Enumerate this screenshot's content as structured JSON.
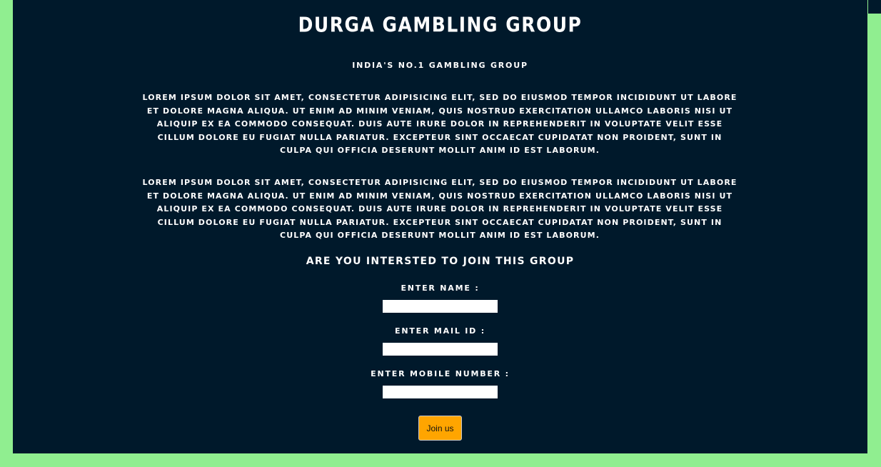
{
  "header": {
    "title": "DURGA GAMBLING GROUP",
    "subtitle": "INDIA'S NO.1 GAMBLING GROUP"
  },
  "content": {
    "paragraphs": [
      "LOREM IPSUM DOLOR SIT AMET, CONSECTETUR ADIPISICING ELIT, SED DO EIUSMOD TEMPOR INCIDIDUNT UT LABORE ET DOLORE MAGNA ALIQUA. UT ENIM AD MINIM VENIAM, QUIS NOSTRUD EXERCITATION ULLAMCO LABORIS NISI UT ALIQUIP EX EA COMMODO CONSEQUAT. DUIS AUTE IRURE DOLOR IN REPREHENDERIT IN VOLUPTATE VELIT ESSE CILLUM DOLORE EU FUGIAT NULLA PARIATUR. EXCEPTEUR SINT OCCAECAT CUPIDATAT NON PROIDENT, SUNT IN CULPA QUI OFFICIA DESERUNT MOLLIT ANIM ID EST LABORUM.",
      "LOREM IPSUM DOLOR SIT AMET, CONSECTETUR ADIPISICING ELIT, SED DO EIUSMOD TEMPOR INCIDIDUNT UT LABORE ET DOLORE MAGNA ALIQUA. UT ENIM AD MINIM VENIAM, QUIS NOSTRUD EXERCITATION ULLAMCO LABORIS NISI UT ALIQUIP EX EA COMMODO CONSEQUAT. DUIS AUTE IRURE DOLOR IN REPREHENDERIT IN VOLUPTATE VELIT ESSE CILLUM DOLORE EU FUGIAT NULLA PARIATUR. EXCEPTEUR SINT OCCAECAT CUPIDATAT NON PROIDENT, SUNT IN CULPA QUI OFFICIA DESERUNT MOLLIT ANIM ID EST LABORUM."
    ]
  },
  "form": {
    "question": "ARE YOU INTERSTED TO JOIN THIS GROUP",
    "name_label": "ENTER NAME :",
    "name_value": "",
    "mail_label": "ENTER MAIL ID :",
    "mail_value": "",
    "mobile_label": "ENTER MOBILE NUMBER :",
    "mobile_value": "",
    "submit_label": "Join us"
  },
  "colors": {
    "page_background": "#90ee90",
    "panel_background": "#00192b",
    "text": "#ffffff",
    "button": "#ffa500"
  }
}
